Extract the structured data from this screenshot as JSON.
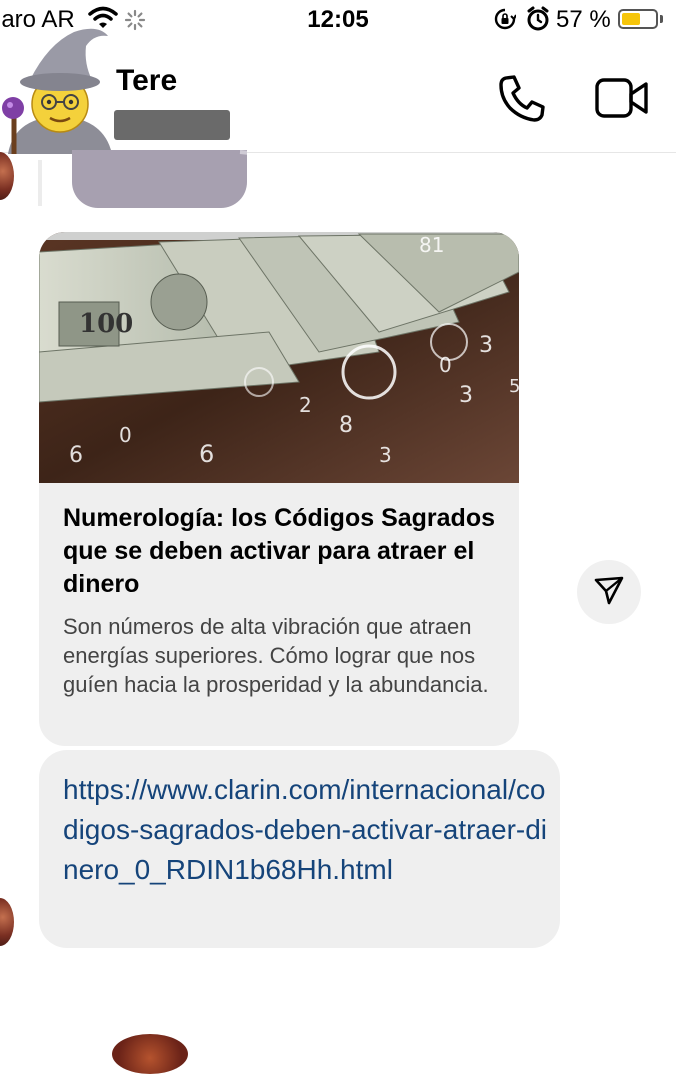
{
  "status_bar": {
    "carrier": "laro AR",
    "time": "12:05",
    "battery_percent": "57 %",
    "battery_level": 0.57,
    "icons": [
      "wifi-icon",
      "loading-spinner-icon",
      "orientation-lock-icon",
      "alarm-icon",
      "battery-icon"
    ]
  },
  "header": {
    "contact_name": "Tere",
    "avatar": "wizard-emoji-avatar",
    "icons": [
      "phone-icon",
      "video-camera-icon"
    ]
  },
  "message": {
    "card": {
      "title": "Numerología: los Códigos Sagrados que se deben activar para atraer el dinero",
      "description": "Son números de alta vibración que atraen energías superiores. Cómo lograr que nos guíen hacia la prosperidad y la abundancia."
    },
    "link": "https://www.clarin.com/internacional/codigos-sagrados-deben-activar-atraer-dinero_0_RDIN1b68Hh.html"
  },
  "actions": {
    "share_icon": "send-icon"
  },
  "colors": {
    "bubble": "#efefef",
    "link": "#15447a",
    "battery": "#f6c50a"
  }
}
